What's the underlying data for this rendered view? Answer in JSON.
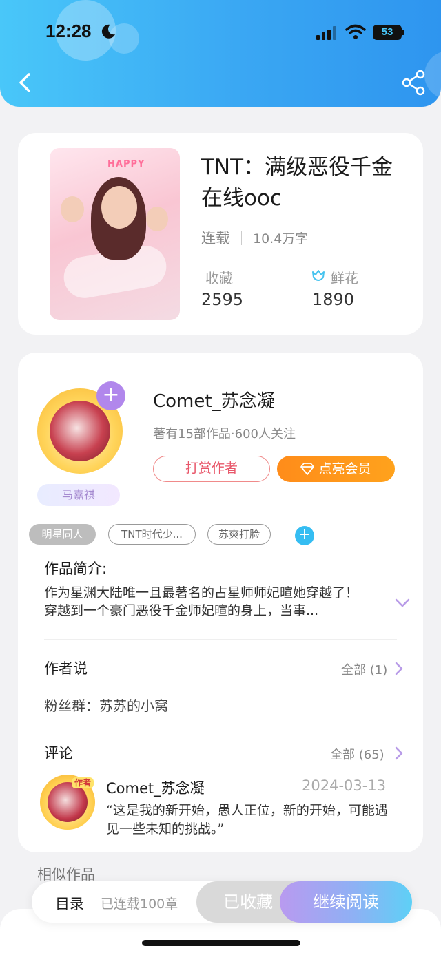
{
  "status_bar": {
    "time": "12:28",
    "battery": "53"
  },
  "book": {
    "title": "TNT：满级恶役千金在线ooc",
    "status": "连载",
    "word_count": "10.4万字",
    "favorites_label": "收藏",
    "favorites_value": "2595",
    "flowers_label": "鲜花",
    "flowers_value": "1890",
    "cover_text": "HAPPY"
  },
  "author": {
    "name": "Comet_苏念凝",
    "meta": "著有15部作品·600人关注",
    "fan_tag": "马嘉祺",
    "reward_label": "打赏作者",
    "vip_label": "点亮会员"
  },
  "tags": [
    "明星同人",
    "TNT时代少...",
    "苏爽打脸"
  ],
  "intro": {
    "title": "作品简介:",
    "text": "作为星渊大陆唯一且最著名的占星师师妃暄她穿越了！穿越到一个豪门恶役千金师妃暄的身上，当事..."
  },
  "author_says": {
    "title": "作者说",
    "all_label": "全部 (1)",
    "text": "粉丝群：苏苏的小窝"
  },
  "comments": {
    "title": "评论",
    "all_label": "全部 (65)",
    "items": [
      {
        "badge": "作者",
        "name": "Comet_苏念凝",
        "date": "2024-03-13",
        "text": "“这是我的新开始，愚人正位，新的开始，可能遇见一些未知的挑战。”"
      }
    ]
  },
  "similar_title": "相似作品",
  "bottom": {
    "toc_label": "目录",
    "chapter_label": "已连载100章",
    "collected_label": "已收藏",
    "read_label": "继续阅读"
  },
  "colors": {
    "header_start": "#49c7f9",
    "header_end": "#2e95ef",
    "vip_orange": "#ff8c1a",
    "accent_purple": "#b187ec",
    "tag_add_blue": "#35bdf2"
  }
}
